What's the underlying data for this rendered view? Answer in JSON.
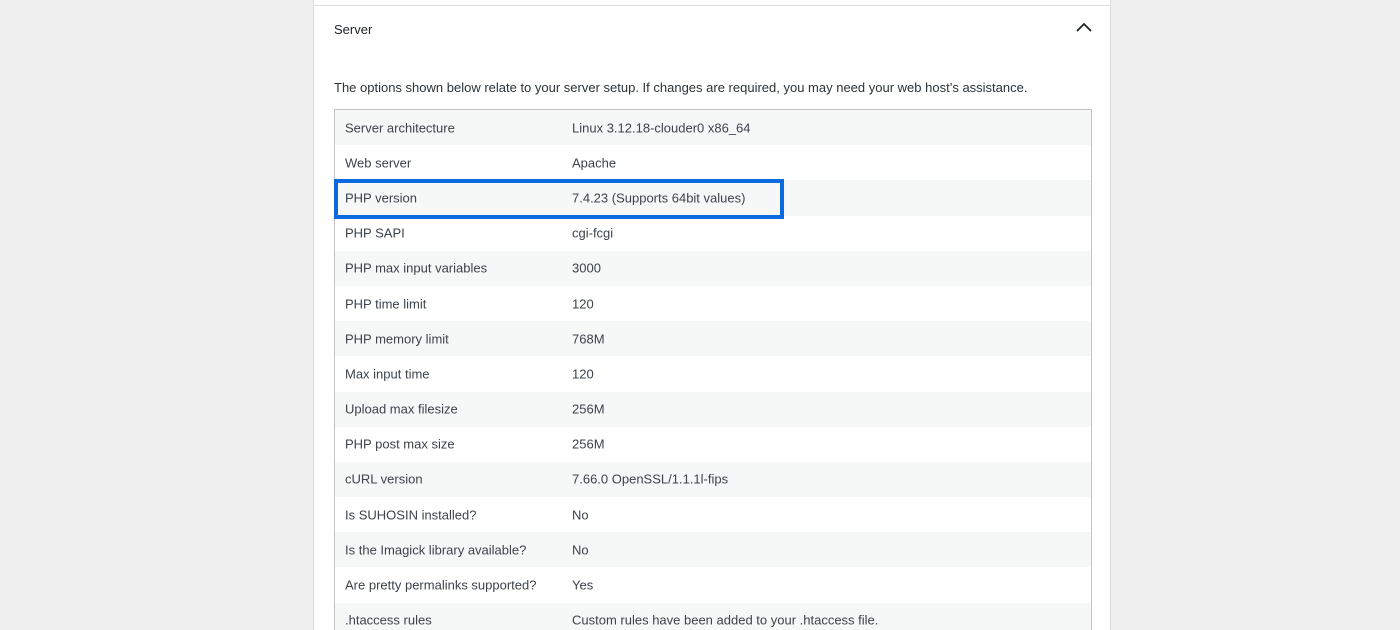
{
  "section": {
    "title": "Server",
    "description": "The options shown below relate to your server setup. If changes are required, you may need your web host’s assistance.",
    "expanded": true
  },
  "rows": [
    {
      "label": "Server architecture",
      "value": "Linux 3.12.18-clouder0 x86_64"
    },
    {
      "label": "Web server",
      "value": "Apache"
    },
    {
      "label": "PHP version",
      "value": "7.4.23 (Supports 64bit values)"
    },
    {
      "label": "PHP SAPI",
      "value": "cgi-fcgi"
    },
    {
      "label": "PHP max input variables",
      "value": "3000"
    },
    {
      "label": "PHP time limit",
      "value": "120"
    },
    {
      "label": "PHP memory limit",
      "value": "768M"
    },
    {
      "label": "Max input time",
      "value": "120"
    },
    {
      "label": "Upload max filesize",
      "value": "256M"
    },
    {
      "label": "PHP post max size",
      "value": "256M"
    },
    {
      "label": "cURL version",
      "value": "7.66.0 OpenSSL/1.1.1l-fips"
    },
    {
      "label": "Is SUHOSIN installed?",
      "value": "No"
    },
    {
      "label": "Is the Imagick library available?",
      "value": "No"
    },
    {
      "label": "Are pretty permalinks supported?",
      "value": "Yes"
    },
    {
      "label": ".htaccess rules",
      "value": "Custom rules have been added to your .htaccess file."
    }
  ],
  "highlight": {
    "row": "PHP version",
    "color": "#0a6be0"
  },
  "icons": {
    "toggle": "chevron-up-icon"
  }
}
